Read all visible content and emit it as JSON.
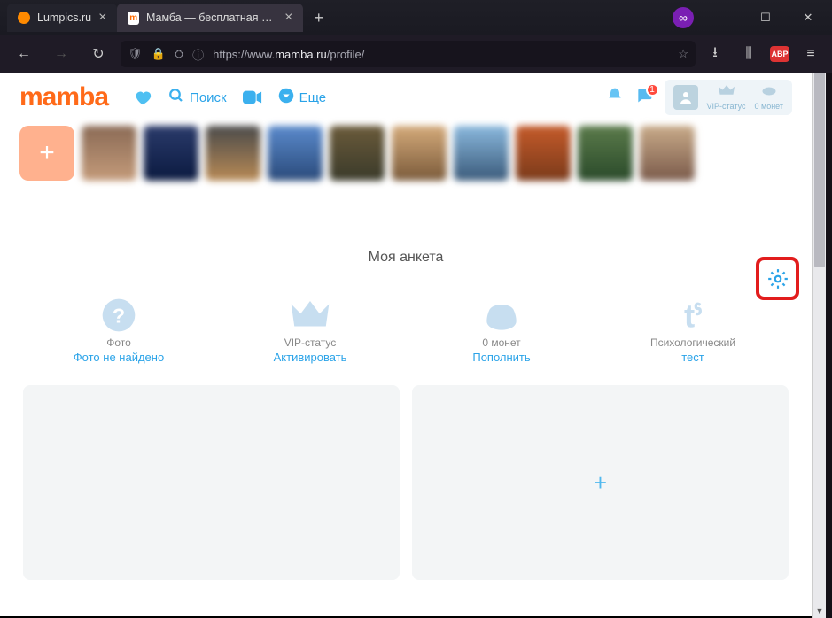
{
  "browser": {
    "tabs": [
      {
        "title": "Lumpics.ru",
        "active": false
      },
      {
        "title": "Мамба — бесплатная сеть зна",
        "active": true
      }
    ],
    "newtab_glyph": "+",
    "extension_glyph": "∞",
    "win": {
      "min": "—",
      "max": "☐",
      "close": "✕"
    }
  },
  "address": {
    "nav": {
      "back": "←",
      "fwd": "→",
      "reload": "↻"
    },
    "shield": "🛡",
    "lock": "🔒",
    "perm": "⛭",
    "info": "ⓘ",
    "url_prefix": "https://www.",
    "url_domain": "mamba.ru",
    "url_path": "/profile/",
    "star": "☆",
    "dl": "⭳",
    "lib": "⫼",
    "abp": "ABP",
    "menu": "≡"
  },
  "mamba": {
    "logo": "mamba",
    "nav": {
      "search_label": "Поиск",
      "more_label": "Еще"
    },
    "notif_badge": "1",
    "userzone": {
      "vip": "VIP-статус",
      "coins": "0 монет"
    }
  },
  "strip": {
    "add_glyph": "+"
  },
  "section_title": "Моя анкета",
  "cards": {
    "photo": {
      "label": "Фото",
      "link": "Фото не найдено"
    },
    "vip": {
      "label": "VIP-статус",
      "link": "Активировать"
    },
    "coins": {
      "label": "0 монет",
      "link": "Пополнить"
    },
    "test": {
      "label": "Психологический",
      "link": "тест"
    }
  },
  "panel_plus": "+"
}
